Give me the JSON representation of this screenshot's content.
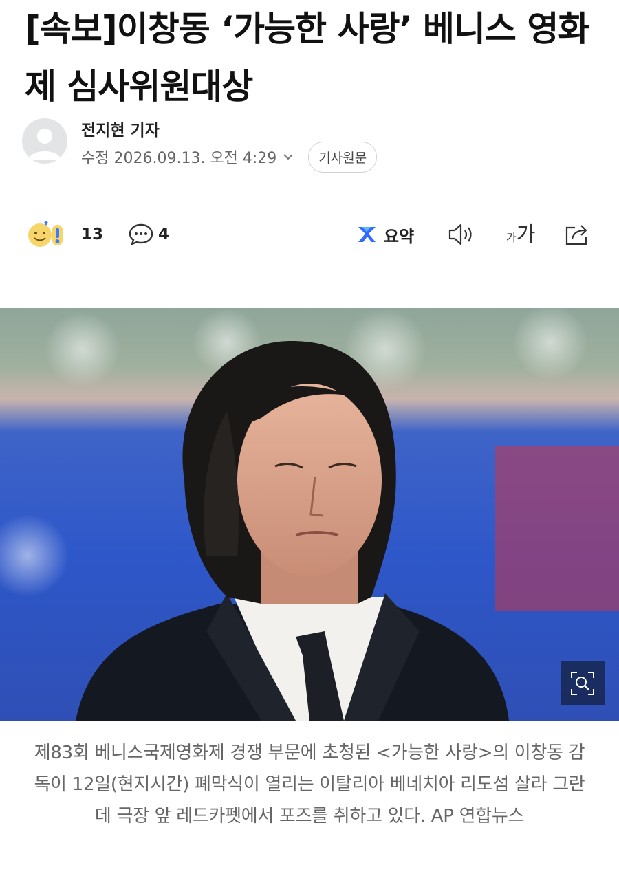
{
  "article": {
    "headline": "[속보]이창동 ‘가능한 사랑’ 베니스 영화제 심사위원대상",
    "reporter": "전지현 기자",
    "modified": "수정 2026.09.13. 오전 4:29",
    "source_button": "기사원문"
  },
  "toolbar": {
    "reaction_count": "13",
    "comment_count": "4",
    "summary_label": "요약",
    "font_small": "가",
    "font_big": "가"
  },
  "photo": {
    "alt_icon": "magnifier-zoom-icon"
  },
  "caption": {
    "text": "제83회 베니스국제영화제 경쟁 부문에 초청된 <가능한 사랑>의 이창동 감독이 12일(현지시간) 폐막식이 열리는 이탈리아 베네치아 리도섬 살라 그란데 극장 앞 레드카펫에서 포즈를 취하고 있다. AP 연합뉴스"
  },
  "colors": {
    "accent_summary": "#2f6bff",
    "caption_text": "#666666"
  }
}
